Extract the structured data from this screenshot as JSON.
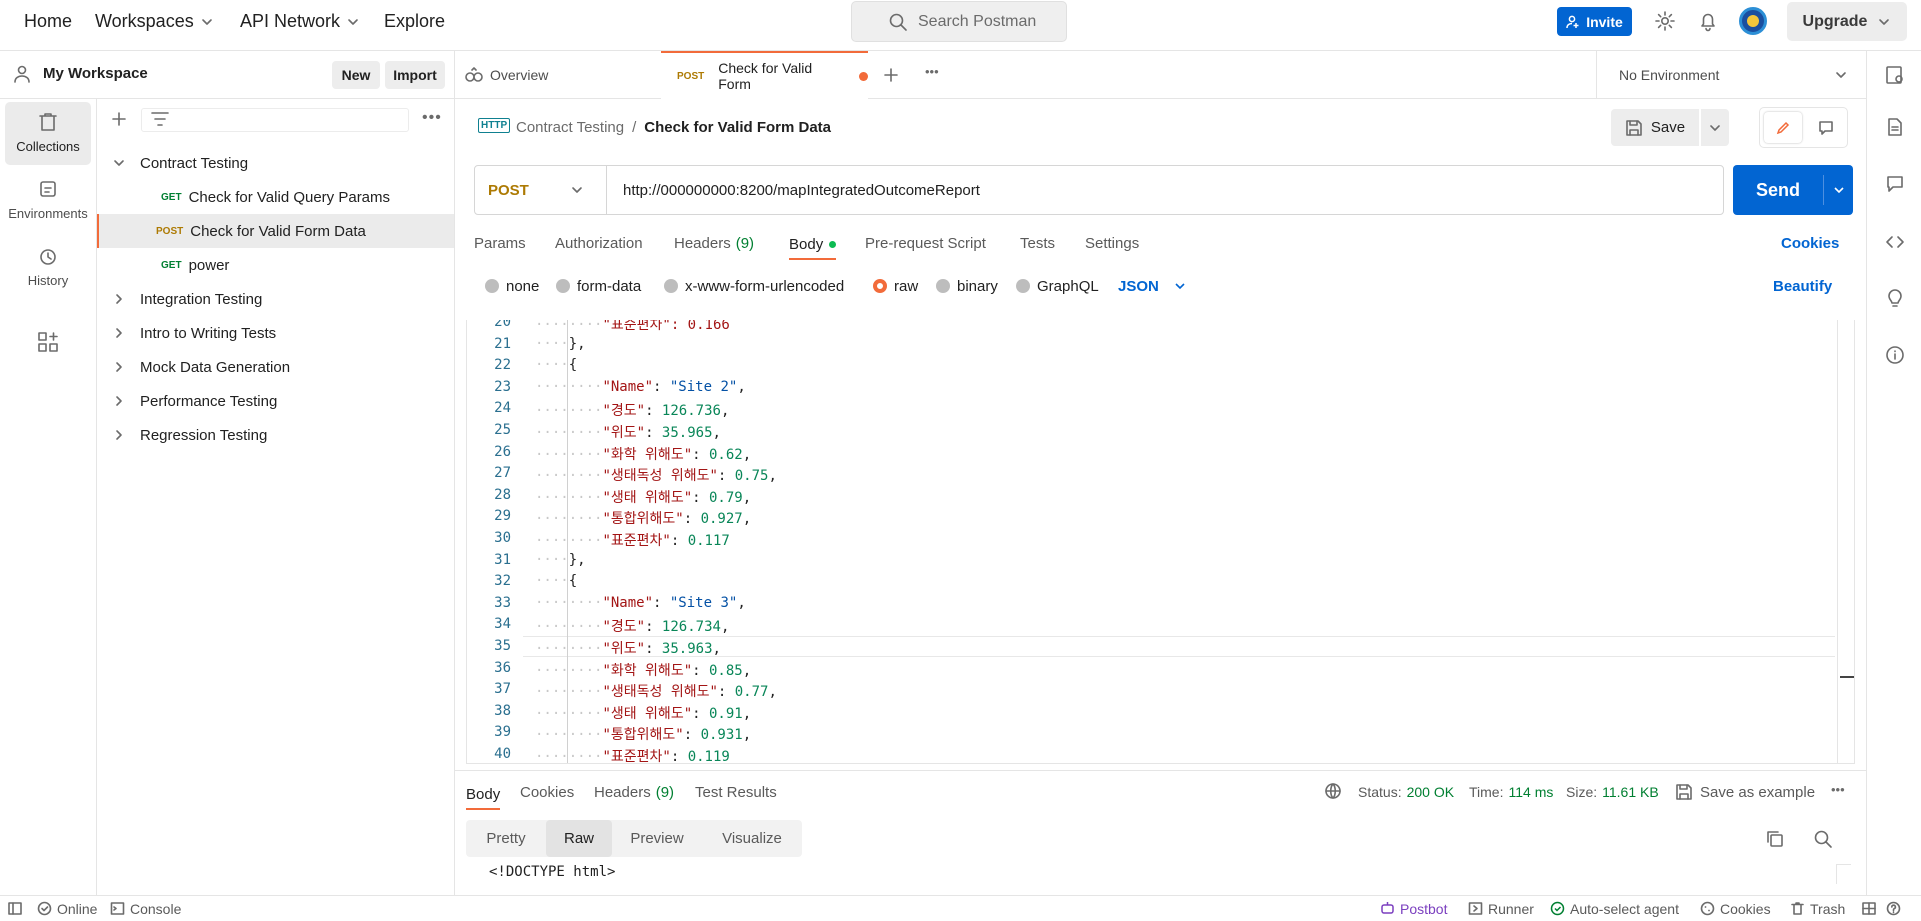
{
  "topbar": {
    "home": "Home",
    "workspaces": "Workspaces",
    "api_network": "API Network",
    "explore": "Explore",
    "search_placeholder": "Search Postman",
    "invite": "Invite",
    "upgrade": "Upgrade"
  },
  "workspace": {
    "name": "My Workspace",
    "new_label": "New",
    "import_label": "Import"
  },
  "rail": {
    "collections": "Collections",
    "environments": "Environments",
    "history": "History"
  },
  "collections": [
    {
      "label": "Contract Testing",
      "expanded": true
    },
    {
      "label": "Integration Testing"
    },
    {
      "label": "Intro to Writing Tests"
    },
    {
      "label": "Mock Data Generation"
    },
    {
      "label": "Performance Testing"
    },
    {
      "label": "Regression Testing"
    }
  ],
  "requests": [
    {
      "method": "GET",
      "label": "Check for Valid Query Params"
    },
    {
      "method": "POST",
      "label": "Check for Valid Form Data",
      "selected": true
    },
    {
      "method": "GET",
      "label": "power"
    }
  ],
  "tabs": {
    "overview": "Overview",
    "active_method": "POST",
    "active_label": "Check for Valid Form",
    "environment": "No Environment"
  },
  "request": {
    "breadcrumb_parent": "Contract Testing",
    "breadcrumb_sep": "/",
    "title": "Check for Valid Form Data",
    "http_badge": "HTTP",
    "save": "Save",
    "method": "POST",
    "url": "http://000000000:8200/mapIntegratedOutcomeReport",
    "send": "Send",
    "tabs": {
      "params": "Params",
      "authorization": "Authorization",
      "headers": "Headers",
      "headers_count": "(9)",
      "body": "Body",
      "prerequest": "Pre-request Script",
      "tests": "Tests",
      "settings": "Settings",
      "cookies": "Cookies"
    },
    "body_modes": {
      "none": "none",
      "form_data": "form-data",
      "urlencoded": "x-www-form-urlencoded",
      "raw": "raw",
      "binary": "binary",
      "graphql": "GraphQL",
      "format": "JSON",
      "beautify": "Beautify"
    }
  },
  "editor": {
    "partial_top": "\"표준편차\": 0.166",
    "lines": [
      {
        "n": "20",
        "t": "partial"
      },
      {
        "n": "21",
        "t": "close"
      },
      {
        "n": "22",
        "t": "open"
      },
      {
        "n": "23",
        "key": "\"Name\"",
        "val": "\"Site 2\"",
        "vtype": "s",
        "comma": true
      },
      {
        "n": "24",
        "key": "\"경도\"",
        "val": "126.736",
        "vtype": "n",
        "comma": true
      },
      {
        "n": "25",
        "key": "\"위도\"",
        "val": "35.965",
        "vtype": "n",
        "comma": true
      },
      {
        "n": "26",
        "key": "\"화학 위해도\"",
        "val": "0.62",
        "vtype": "n",
        "comma": true
      },
      {
        "n": "27",
        "key": "\"생태독성 위해도\"",
        "val": "0.75",
        "vtype": "n",
        "comma": true
      },
      {
        "n": "28",
        "key": "\"생태 위해도\"",
        "val": "0.79",
        "vtype": "n",
        "comma": true
      },
      {
        "n": "29",
        "key": "\"통합위해도\"",
        "val": "0.927",
        "vtype": "n",
        "comma": true
      },
      {
        "n": "30",
        "key": "\"표준편차\"",
        "val": "0.117",
        "vtype": "n",
        "comma": false
      },
      {
        "n": "31",
        "t": "close"
      },
      {
        "n": "32",
        "t": "open"
      },
      {
        "n": "33",
        "key": "\"Name\"",
        "val": "\"Site 3\"",
        "vtype": "s",
        "comma": true
      },
      {
        "n": "34",
        "key": "\"경도\"",
        "val": "126.734",
        "vtype": "n",
        "comma": true
      },
      {
        "n": "35",
        "key": "\"위도\"",
        "val": "35.963",
        "vtype": "n",
        "comma": true
      },
      {
        "n": "36",
        "key": "\"화학 위해도\"",
        "val": "0.85",
        "vtype": "n",
        "comma": true
      },
      {
        "n": "37",
        "key": "\"생태독성 위해도\"",
        "val": "0.77",
        "vtype": "n",
        "comma": true
      },
      {
        "n": "38",
        "key": "\"생태 위해도\"",
        "val": "0.91",
        "vtype": "n",
        "comma": true
      },
      {
        "n": "39",
        "key": "\"통합위해도\"",
        "val": "0.931",
        "vtype": "n",
        "comma": true
      },
      {
        "n": "40",
        "key": "\"표준편차\"",
        "val": "0.119",
        "vtype": "n",
        "comma": false
      }
    ]
  },
  "response": {
    "tabs": {
      "body": "Body",
      "cookies": "Cookies",
      "headers": "Headers",
      "headers_count": "(9)",
      "test_results": "Test Results"
    },
    "status_label": "Status:",
    "status_value": "200 OK",
    "time_label": "Time:",
    "time_value": "114 ms",
    "size_label": "Size:",
    "size_value": "11.61 KB",
    "save_example": "Save as example",
    "views": [
      "Pretty",
      "Raw",
      "Preview",
      "Visualize"
    ],
    "active_view": "Raw",
    "body_first_line": "<!DOCTYPE html>"
  },
  "footer": {
    "online": "Online",
    "console": "Console",
    "postbot": "Postbot",
    "runner": "Runner",
    "auto_select": "Auto-select agent",
    "cookies": "Cookies",
    "trash": "Trash"
  },
  "colors": {
    "accent_orange": "#f26b3a",
    "brand_blue": "#0265d2",
    "get_green": "#007f31",
    "post_orange": "#ad7a03",
    "status_green": "#007f31"
  }
}
